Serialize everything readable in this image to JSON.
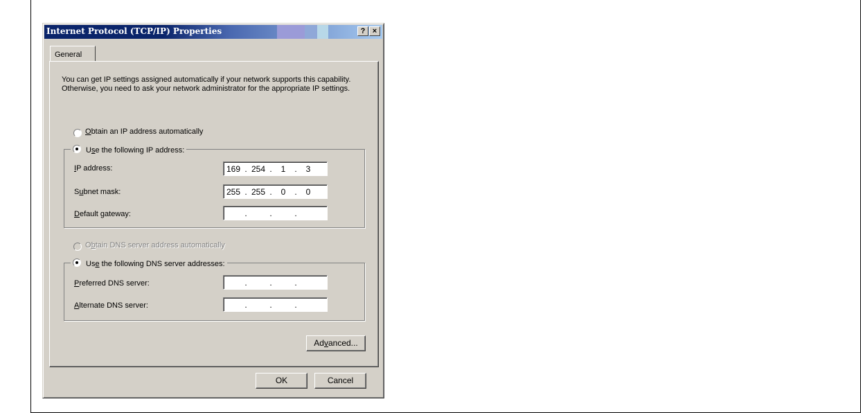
{
  "dialog": {
    "title": "Internet Protocol (TCP/IP) Properties",
    "help_button": "?",
    "close_button": "×"
  },
  "tabs": [
    {
      "label": "General"
    }
  ],
  "description": "You can get IP settings assigned automatically if your network supports this capability. Otherwise, you need to ask your network administrator for the appropriate IP settings.",
  "ip_section": {
    "obtain_auto": {
      "label": "Obtain an IP address automatically",
      "checked": false
    },
    "use_following": {
      "label": "Use the following IP address:",
      "checked": true
    },
    "fields": [
      {
        "label": "IP address:",
        "octets": [
          "169",
          "254",
          "1",
          "3"
        ]
      },
      {
        "label": "Subnet mask:",
        "octets": [
          "255",
          "255",
          "0",
          "0"
        ]
      },
      {
        "label": "Default gateway:",
        "octets": [
          "",
          "",
          "",
          ""
        ]
      }
    ]
  },
  "dns_section": {
    "obtain_auto": {
      "label": "Obtain DNS server address automatically",
      "checked": false,
      "disabled": true
    },
    "use_following": {
      "label": "Use the following DNS server addresses:",
      "checked": true
    },
    "fields": [
      {
        "label": "Preferred DNS server:",
        "octets": [
          "",
          "",
          "",
          ""
        ]
      },
      {
        "label": "Alternate DNS server:",
        "octets": [
          "",
          "",
          "",
          ""
        ]
      }
    ]
  },
  "buttons": {
    "advanced": "Advanced...",
    "ok": "OK",
    "cancel": "Cancel"
  },
  "colors": {
    "title_bar_start": "#0a246a",
    "title_bar_end": "#a6caf0",
    "dialog_face": "#d4d0c8"
  }
}
